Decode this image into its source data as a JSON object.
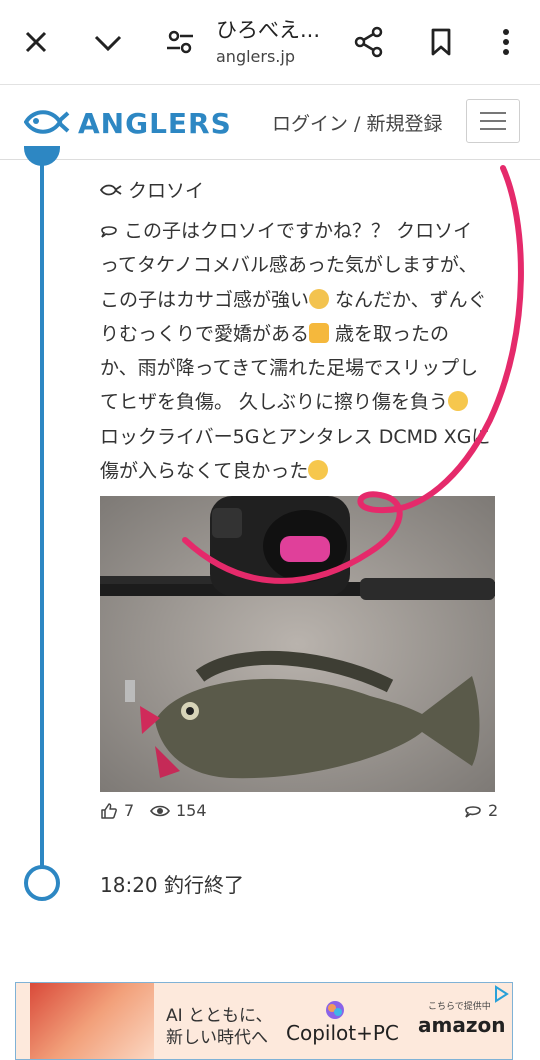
{
  "browser": {
    "title": "ひろべえ...",
    "url": "anglers.jp"
  },
  "site": {
    "logo_text": "ANGLERS",
    "login_link": "ログイン / 新規登録",
    "brand_color": "#2d87c3"
  },
  "entry": {
    "species": "クロソイ",
    "text_lines": [
      "この子はクロソイですかね？？ クロソイ",
      "ってタケノコメバル感あった気がしますが、",
      "この子はカサゴ感が強い",
      " なんだか、ずんぐ",
      "りむっくりで愛嬌がある",
      " 歳を取ったの",
      "か、雨が降ってきて濡れた足場でスリップし",
      "てヒザを負傷。 久しぶりに擦り傷を負う",
      "ロックライバー5Gとアンタレス DCMD XGに",
      "傷が入らなくて良かった"
    ],
    "likes": "7",
    "views": "154",
    "comments": "2"
  },
  "timeline_end": {
    "label": "18:20 釣行終了"
  },
  "ad": {
    "line1": "AI とともに、",
    "line2": "新しい時代へ",
    "brand": "Copilot+PC",
    "note": "こちらで提供中",
    "store": "amazon"
  }
}
